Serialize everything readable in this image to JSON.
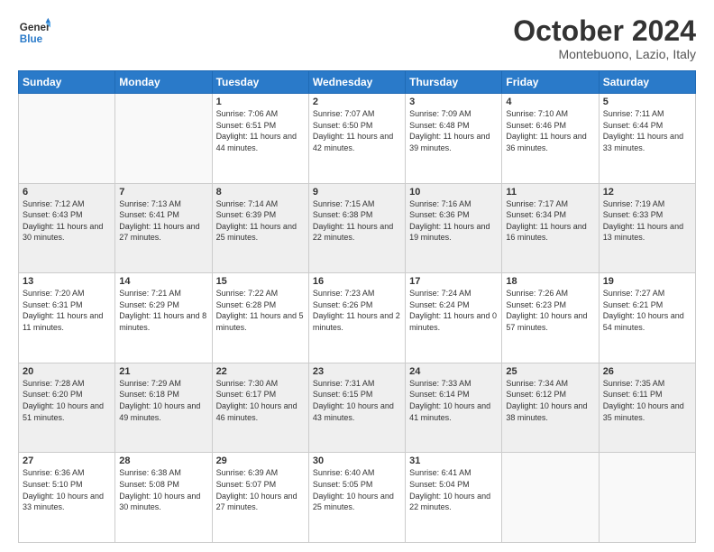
{
  "header": {
    "logo_line1": "General",
    "logo_line2": "Blue",
    "month": "October 2024",
    "location": "Montebuono, Lazio, Italy"
  },
  "days_of_week": [
    "Sunday",
    "Monday",
    "Tuesday",
    "Wednesday",
    "Thursday",
    "Friday",
    "Saturday"
  ],
  "weeks": [
    [
      {
        "day": "",
        "sunrise": "",
        "sunset": "",
        "daylight": ""
      },
      {
        "day": "",
        "sunrise": "",
        "sunset": "",
        "daylight": ""
      },
      {
        "day": "1",
        "sunrise": "Sunrise: 7:06 AM",
        "sunset": "Sunset: 6:51 PM",
        "daylight": "Daylight: 11 hours and 44 minutes."
      },
      {
        "day": "2",
        "sunrise": "Sunrise: 7:07 AM",
        "sunset": "Sunset: 6:50 PM",
        "daylight": "Daylight: 11 hours and 42 minutes."
      },
      {
        "day": "3",
        "sunrise": "Sunrise: 7:09 AM",
        "sunset": "Sunset: 6:48 PM",
        "daylight": "Daylight: 11 hours and 39 minutes."
      },
      {
        "day": "4",
        "sunrise": "Sunrise: 7:10 AM",
        "sunset": "Sunset: 6:46 PM",
        "daylight": "Daylight: 11 hours and 36 minutes."
      },
      {
        "day": "5",
        "sunrise": "Sunrise: 7:11 AM",
        "sunset": "Sunset: 6:44 PM",
        "daylight": "Daylight: 11 hours and 33 minutes."
      }
    ],
    [
      {
        "day": "6",
        "sunrise": "Sunrise: 7:12 AM",
        "sunset": "Sunset: 6:43 PM",
        "daylight": "Daylight: 11 hours and 30 minutes."
      },
      {
        "day": "7",
        "sunrise": "Sunrise: 7:13 AM",
        "sunset": "Sunset: 6:41 PM",
        "daylight": "Daylight: 11 hours and 27 minutes."
      },
      {
        "day": "8",
        "sunrise": "Sunrise: 7:14 AM",
        "sunset": "Sunset: 6:39 PM",
        "daylight": "Daylight: 11 hours and 25 minutes."
      },
      {
        "day": "9",
        "sunrise": "Sunrise: 7:15 AM",
        "sunset": "Sunset: 6:38 PM",
        "daylight": "Daylight: 11 hours and 22 minutes."
      },
      {
        "day": "10",
        "sunrise": "Sunrise: 7:16 AM",
        "sunset": "Sunset: 6:36 PM",
        "daylight": "Daylight: 11 hours and 19 minutes."
      },
      {
        "day": "11",
        "sunrise": "Sunrise: 7:17 AM",
        "sunset": "Sunset: 6:34 PM",
        "daylight": "Daylight: 11 hours and 16 minutes."
      },
      {
        "day": "12",
        "sunrise": "Sunrise: 7:19 AM",
        "sunset": "Sunset: 6:33 PM",
        "daylight": "Daylight: 11 hours and 13 minutes."
      }
    ],
    [
      {
        "day": "13",
        "sunrise": "Sunrise: 7:20 AM",
        "sunset": "Sunset: 6:31 PM",
        "daylight": "Daylight: 11 hours and 11 minutes."
      },
      {
        "day": "14",
        "sunrise": "Sunrise: 7:21 AM",
        "sunset": "Sunset: 6:29 PM",
        "daylight": "Daylight: 11 hours and 8 minutes."
      },
      {
        "day": "15",
        "sunrise": "Sunrise: 7:22 AM",
        "sunset": "Sunset: 6:28 PM",
        "daylight": "Daylight: 11 hours and 5 minutes."
      },
      {
        "day": "16",
        "sunrise": "Sunrise: 7:23 AM",
        "sunset": "Sunset: 6:26 PM",
        "daylight": "Daylight: 11 hours and 2 minutes."
      },
      {
        "day": "17",
        "sunrise": "Sunrise: 7:24 AM",
        "sunset": "Sunset: 6:24 PM",
        "daylight": "Daylight: 11 hours and 0 minutes."
      },
      {
        "day": "18",
        "sunrise": "Sunrise: 7:26 AM",
        "sunset": "Sunset: 6:23 PM",
        "daylight": "Daylight: 10 hours and 57 minutes."
      },
      {
        "day": "19",
        "sunrise": "Sunrise: 7:27 AM",
        "sunset": "Sunset: 6:21 PM",
        "daylight": "Daylight: 10 hours and 54 minutes."
      }
    ],
    [
      {
        "day": "20",
        "sunrise": "Sunrise: 7:28 AM",
        "sunset": "Sunset: 6:20 PM",
        "daylight": "Daylight: 10 hours and 51 minutes."
      },
      {
        "day": "21",
        "sunrise": "Sunrise: 7:29 AM",
        "sunset": "Sunset: 6:18 PM",
        "daylight": "Daylight: 10 hours and 49 minutes."
      },
      {
        "day": "22",
        "sunrise": "Sunrise: 7:30 AM",
        "sunset": "Sunset: 6:17 PM",
        "daylight": "Daylight: 10 hours and 46 minutes."
      },
      {
        "day": "23",
        "sunrise": "Sunrise: 7:31 AM",
        "sunset": "Sunset: 6:15 PM",
        "daylight": "Daylight: 10 hours and 43 minutes."
      },
      {
        "day": "24",
        "sunrise": "Sunrise: 7:33 AM",
        "sunset": "Sunset: 6:14 PM",
        "daylight": "Daylight: 10 hours and 41 minutes."
      },
      {
        "day": "25",
        "sunrise": "Sunrise: 7:34 AM",
        "sunset": "Sunset: 6:12 PM",
        "daylight": "Daylight: 10 hours and 38 minutes."
      },
      {
        "day": "26",
        "sunrise": "Sunrise: 7:35 AM",
        "sunset": "Sunset: 6:11 PM",
        "daylight": "Daylight: 10 hours and 35 minutes."
      }
    ],
    [
      {
        "day": "27",
        "sunrise": "Sunrise: 6:36 AM",
        "sunset": "Sunset: 5:10 PM",
        "daylight": "Daylight: 10 hours and 33 minutes."
      },
      {
        "day": "28",
        "sunrise": "Sunrise: 6:38 AM",
        "sunset": "Sunset: 5:08 PM",
        "daylight": "Daylight: 10 hours and 30 minutes."
      },
      {
        "day": "29",
        "sunrise": "Sunrise: 6:39 AM",
        "sunset": "Sunset: 5:07 PM",
        "daylight": "Daylight: 10 hours and 27 minutes."
      },
      {
        "day": "30",
        "sunrise": "Sunrise: 6:40 AM",
        "sunset": "Sunset: 5:05 PM",
        "daylight": "Daylight: 10 hours and 25 minutes."
      },
      {
        "day": "31",
        "sunrise": "Sunrise: 6:41 AM",
        "sunset": "Sunset: 5:04 PM",
        "daylight": "Daylight: 10 hours and 22 minutes."
      },
      {
        "day": "",
        "sunrise": "",
        "sunset": "",
        "daylight": ""
      },
      {
        "day": "",
        "sunrise": "",
        "sunset": "",
        "daylight": ""
      }
    ]
  ]
}
